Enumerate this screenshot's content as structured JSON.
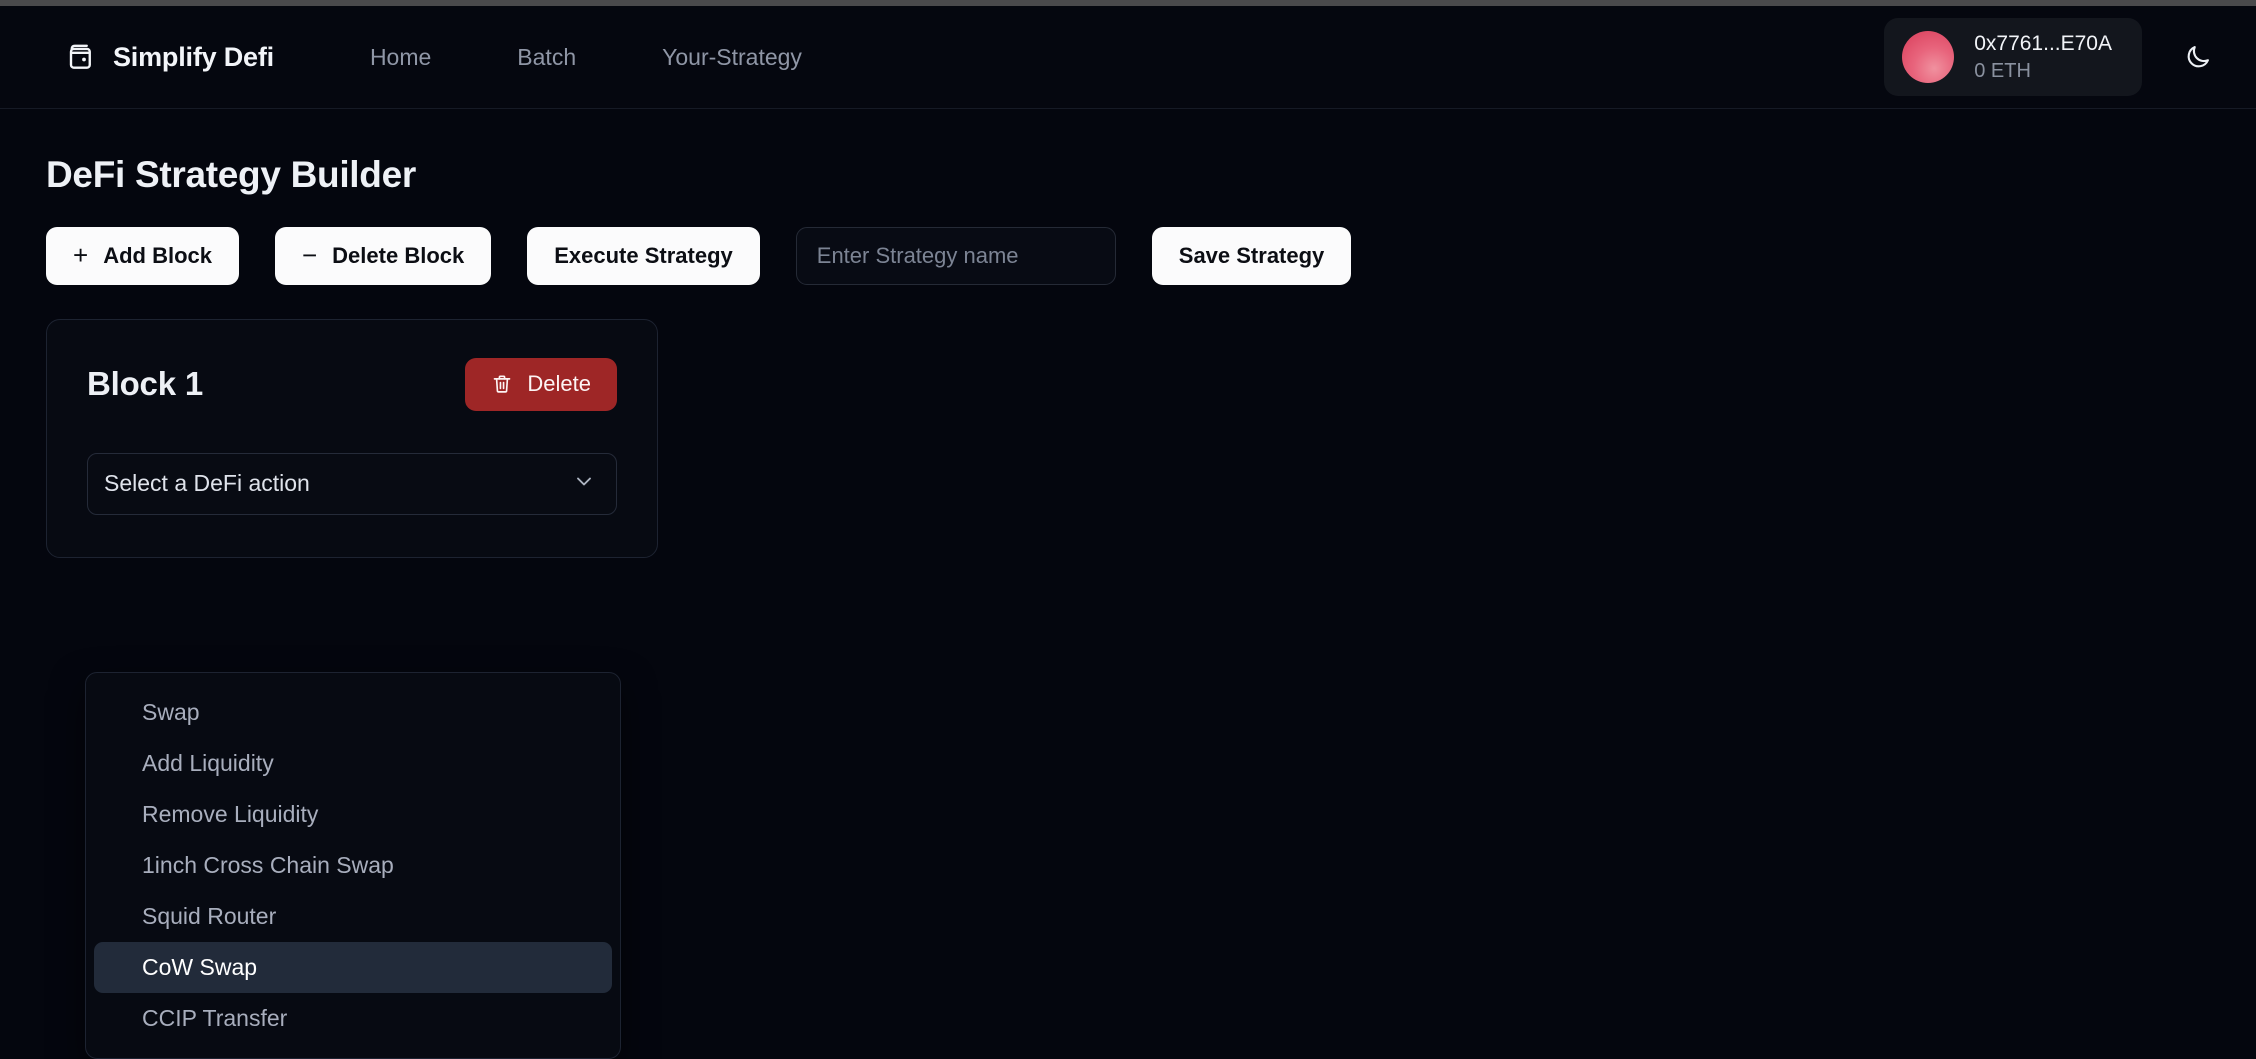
{
  "theme": {
    "page_bg": "#04060e",
    "card_bg": "#070a12",
    "accent_light": "#fbfbfc",
    "danger": "#9e2626",
    "muted_text": "#8f96a6",
    "highlight_bg": "#222b3a"
  },
  "header": {
    "brand_name": "Simplify Defi",
    "brand_icon": "wallet-icon",
    "nav": [
      {
        "label": "Home"
      },
      {
        "label": "Batch"
      },
      {
        "label": "Your-Strategy"
      }
    ],
    "wallet": {
      "address": "0x7761...E70A",
      "balance": "0 ETH",
      "avatar_icon": "avatar-gradient"
    },
    "theme_toggle_icon": "moon-icon"
  },
  "page": {
    "title": "DeFi Strategy Builder"
  },
  "toolbar": {
    "add_block": {
      "sign": "+",
      "label": "Add Block",
      "icon": "plus-icon"
    },
    "delete_block": {
      "sign": "−",
      "label": "Delete Block",
      "icon": "minus-icon"
    },
    "execute_strategy": {
      "label": "Execute Strategy"
    },
    "strategy_name": {
      "value": "",
      "placeholder": "Enter Strategy name"
    },
    "save_strategy": {
      "label": "Save Strategy"
    }
  },
  "blocks": [
    {
      "title": "Block 1",
      "delete_label": "Delete",
      "delete_icon": "trash-icon",
      "select": {
        "value": "Select a DeFi action",
        "caret_icon": "chevron-down-icon",
        "open": true,
        "options": [
          {
            "label": "Swap",
            "selected": false
          },
          {
            "label": "Add Liquidity",
            "selected": false
          },
          {
            "label": "Remove Liquidity",
            "selected": false
          },
          {
            "label": "1inch Cross Chain Swap",
            "selected": false
          },
          {
            "label": "Squid Router",
            "selected": false
          },
          {
            "label": "CoW Swap",
            "selected": true
          },
          {
            "label": "CCIP Transfer",
            "selected": false
          }
        ]
      }
    }
  ]
}
